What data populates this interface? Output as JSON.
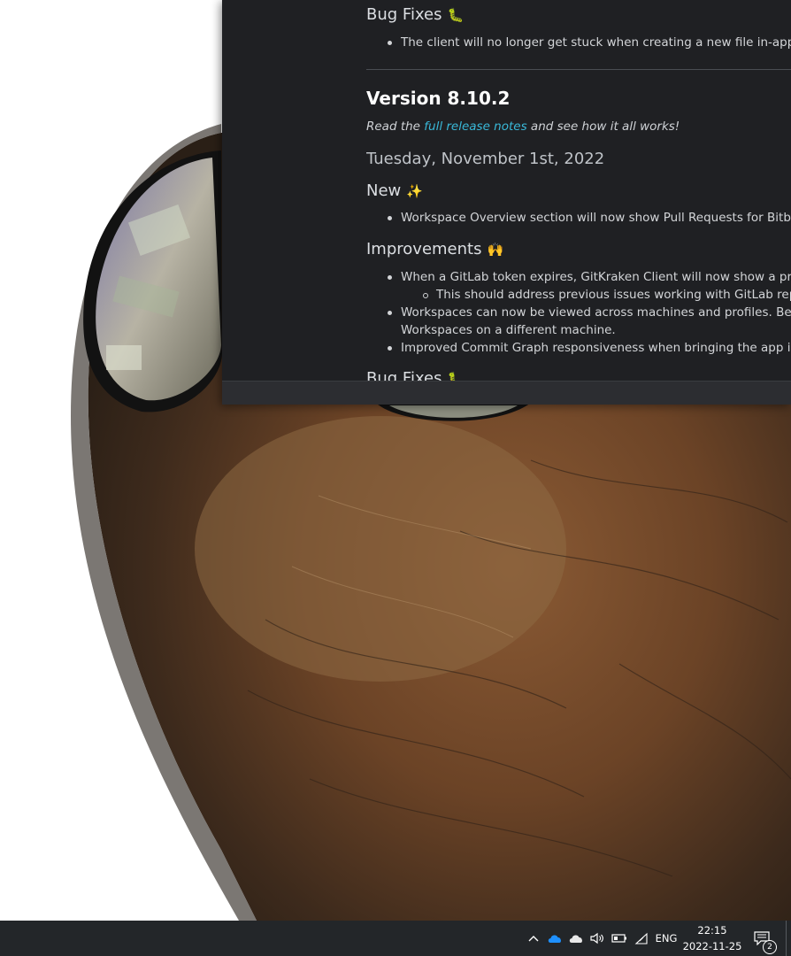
{
  "release_notes": {
    "top_section": {
      "heading": "Bug Fixes",
      "heading_emoji": "🐛",
      "items": [
        "The client will no longer get stuck when creating a new file in-app."
      ]
    },
    "version": {
      "title": "Version 8.10.2",
      "read_prefix": "Read the ",
      "read_link": "full release notes",
      "read_suffix": " and see how it all works!",
      "date": "Tuesday, November 1st, 2022"
    },
    "new_section": {
      "heading": "New",
      "heading_emoji": "✨",
      "items": [
        "Workspace Overview section will now show Pull Requests for Bitbuc"
      ]
    },
    "improvements_section": {
      "heading": "Improvements",
      "heading_emoji": "🙌",
      "items": [
        "When a GitLab token expires, GitKraken Client will now show a prom",
        "This should address previous issues working with GitLab repo",
        "Workspaces can now be viewed across machines and profiles. Be su",
        "Workspaces on a different machine.",
        "Improved Commit Graph responsiveness when bringing the app int"
      ]
    },
    "cut_section": {
      "heading": "Bug Fixes",
      "heading_emoji": "🐛"
    }
  },
  "taskbar": {
    "language": "ENG",
    "time": "22:15",
    "date": "2022-11-25",
    "notification_count": "2",
    "icons": [
      "chevron-up-icon",
      "onedrive-icon",
      "cloud-icon",
      "volume-icon",
      "battery-icon",
      "wifi-icon",
      "action-center-icon"
    ]
  },
  "colors": {
    "window_bg": "#1f2023",
    "link": "#39b8d8",
    "taskbar_bg": "#232629"
  }
}
